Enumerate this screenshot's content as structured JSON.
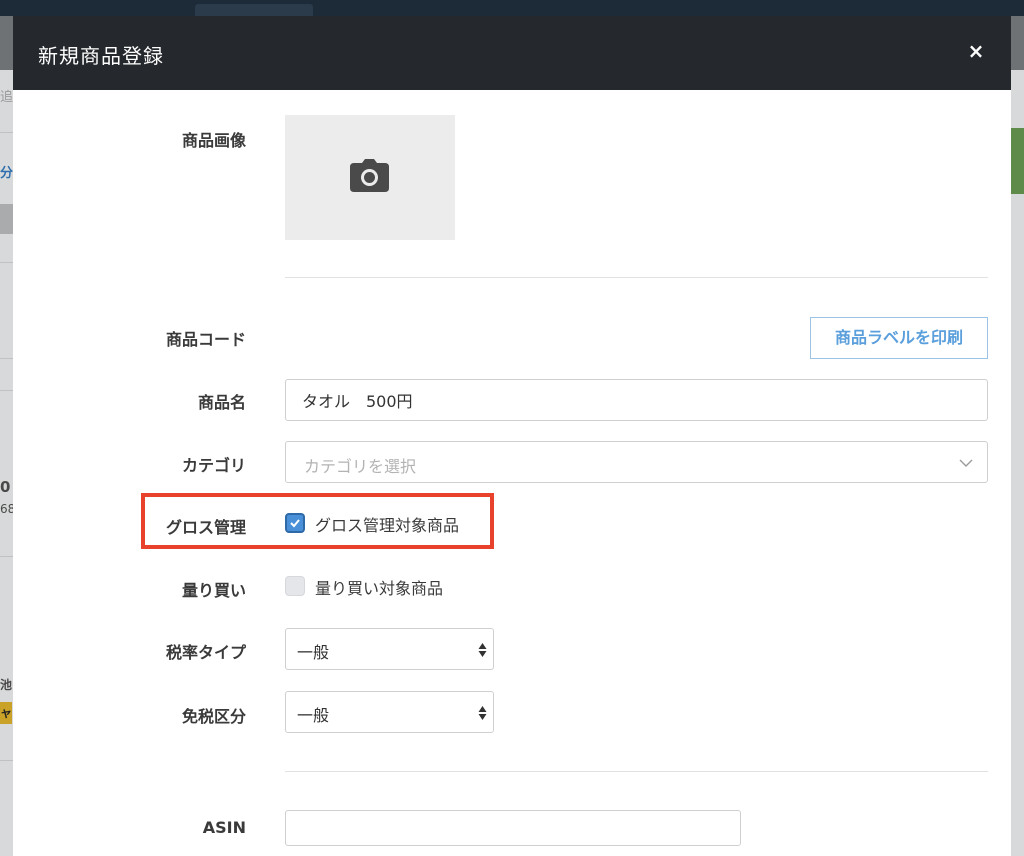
{
  "background": {
    "left_fragments": [
      "追",
      "分",
      "0",
      "68",
      "池",
      "ャ"
    ]
  },
  "modal": {
    "title": "新規商品登録",
    "close_label": "×"
  },
  "form": {
    "image": {
      "label": "商品画像",
      "icon": "camera-icon"
    },
    "code": {
      "label": "商品コード",
      "print_button": "商品ラベルを印刷"
    },
    "name": {
      "label": "商品名",
      "value": "タオル　500円"
    },
    "category": {
      "label": "カテゴリ",
      "placeholder": "カテゴリを選択",
      "icon": "chevron-down-icon"
    },
    "gross": {
      "label": "グロス管理",
      "checkbox_label": "グロス管理対象商品",
      "checked": true
    },
    "bulk": {
      "label": "量り買い",
      "checkbox_label": "量り買い対象商品",
      "checked": false
    },
    "tax_type": {
      "label": "税率タイプ",
      "value": "一般"
    },
    "tax_free": {
      "label": "免税区分",
      "value": "一般"
    },
    "asin": {
      "label": "ASIN",
      "value": ""
    }
  },
  "colors": {
    "header_bg": "#25292d",
    "accent": "#4a90d9",
    "highlight": "#e8412c",
    "print_button_text": "#5a9fdc"
  }
}
